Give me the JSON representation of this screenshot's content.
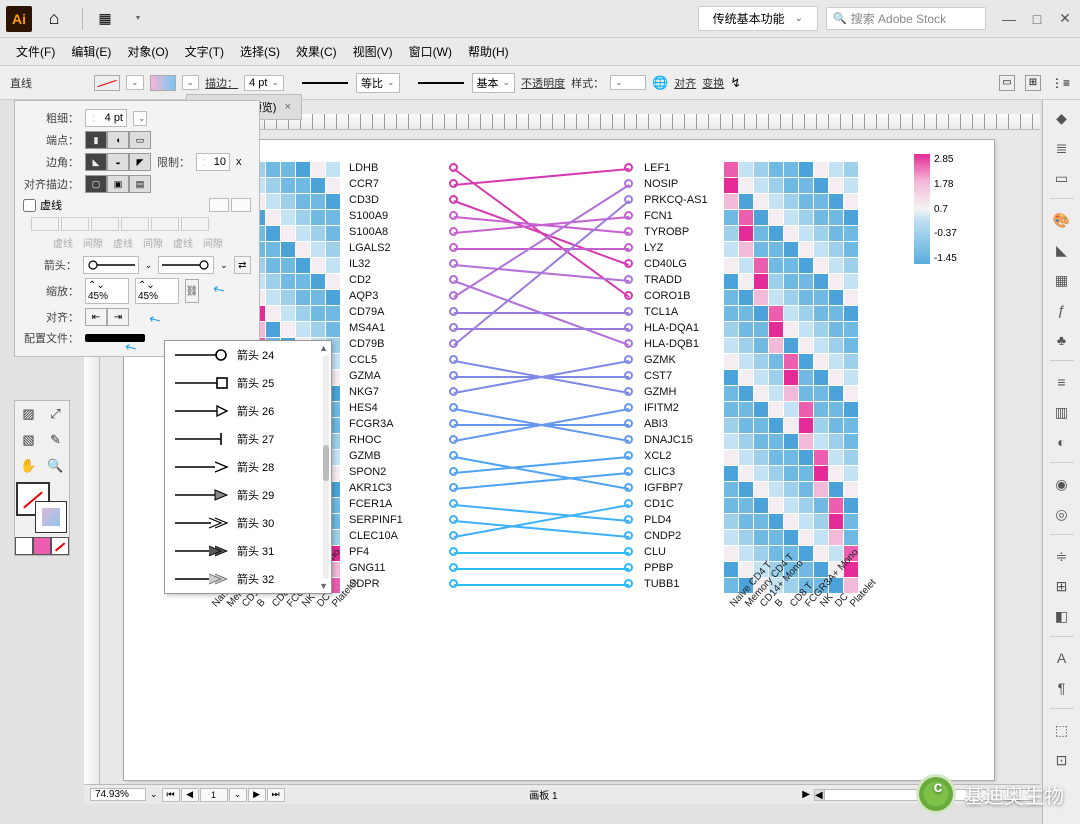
{
  "titlebar": {
    "workspace": "传统基本功能",
    "search_placeholder": "搜索 Adobe Stock"
  },
  "menubar": {
    "items": [
      "文件(F)",
      "编辑(E)",
      "对象(O)",
      "文字(T)",
      "选择(S)",
      "效果(C)",
      "视图(V)",
      "窗口(W)",
      "帮助(H)"
    ]
  },
  "ctrlbar": {
    "tool": "直线",
    "stroke_label": "描边：",
    "stroke_pt": "4 pt",
    "ratio": "等比",
    "profile": "基本",
    "opacity_label": "不透明度",
    "style_label": "样式：",
    "align": "对齐",
    "transform": "变换"
  },
  "doc_tab": {
    "title": "RGB/GPU 预览)",
    "close": "×"
  },
  "stroke_panel": {
    "weight_label": "粗细：",
    "weight_val": "4 pt",
    "cap_label": "端点：",
    "corner_label": "边角：",
    "limit_label": "限制：",
    "limit_val": "10",
    "limit_unit": "x",
    "align_stroke_label": "对齐描边：",
    "dashed_label": "虚线",
    "dash_cols": [
      "虚线",
      "间隙",
      "虚线",
      "间隙",
      "虚线",
      "间隙"
    ],
    "arrow_label": "箭头：",
    "scale_label": "缩放：",
    "scale_val": "45%",
    "align_label": "对齐：",
    "profile_label": "配置文件："
  },
  "arrow_dropdown": {
    "items": [
      "箭头 24",
      "箭头 25",
      "箭头 26",
      "箭头 27",
      "箭头 28",
      "箭头 29",
      "箭头 30",
      "箭头 31",
      "箭头 32"
    ]
  },
  "statusbar": {
    "zoom": "74.93%",
    "artboard_nav": "1",
    "artboard_label": "画板 1"
  },
  "watermark": "基迪奥生物",
  "chart_data": {
    "type": "heatmap",
    "categories_x": [
      "Naive CD4 T",
      "Memory CD4 T",
      "CD14+ Mono",
      "B",
      "CD8 T",
      "FCGR3A+ Mono",
      "NK",
      "DC",
      "Platelet"
    ],
    "genes_left": [
      "LDHB",
      "CCR7",
      "CD3D",
      "S100A9",
      "S100A8",
      "LGALS2",
      "IL32",
      "CD2",
      "AQP3",
      "CD79A",
      "MS4A1",
      "CD79B",
      "CCL5",
      "GZMA",
      "NKG7",
      "HES4",
      "FCGR3A",
      "RHOC",
      "GZMB",
      "SPON2",
      "AKR1C3",
      "FCER1A",
      "SERPINF1",
      "CLEC10A",
      "PF4",
      "GNG11",
      "SDPR"
    ],
    "genes_right": [
      "LEF1",
      "NOSIP",
      "PRKCQ-AS1",
      "FCN1",
      "TYROBP",
      "LYZ",
      "CD40LG",
      "TRADD",
      "CORO1B",
      "TCL1A",
      "HLA-DQA1",
      "HLA-DQB1",
      "GZMK",
      "CST7",
      "GZMH",
      "IFITM2",
      "ABI3",
      "DNAJC15",
      "XCL2",
      "CLIC3",
      "IGFBP7",
      "CD1C",
      "PLD4",
      "CNDP2",
      "CLU",
      "PPBP",
      "TUBB1"
    ],
    "legend": {
      "ticks": [
        "2.85",
        "1.78",
        "0.7",
        "-0.37",
        "-1.45"
      ]
    },
    "connectors": [
      {
        "from": 0,
        "to": 8,
        "color": "#d63ab0"
      },
      {
        "from": 1,
        "to": 0,
        "color": "#d63ab0"
      },
      {
        "from": 2,
        "to": 6,
        "color": "#d63ab0"
      },
      {
        "from": 3,
        "to": 4,
        "color": "#c65fd0"
      },
      {
        "from": 4,
        "to": 3,
        "color": "#c65fd0"
      },
      {
        "from": 5,
        "to": 5,
        "color": "#c65fd0"
      },
      {
        "from": 6,
        "to": 7,
        "color": "#b270d8"
      },
      {
        "from": 7,
        "to": 11,
        "color": "#b270d8"
      },
      {
        "from": 8,
        "to": 1,
        "color": "#b270d8"
      },
      {
        "from": 9,
        "to": 9,
        "color": "#9a7be0"
      },
      {
        "from": 10,
        "to": 10,
        "color": "#9a7be0"
      },
      {
        "from": 11,
        "to": 2,
        "color": "#9a7be0"
      },
      {
        "from": 12,
        "to": 14,
        "color": "#7f8ae8"
      },
      {
        "from": 13,
        "to": 13,
        "color": "#7f8ae8"
      },
      {
        "from": 14,
        "to": 12,
        "color": "#7f8ae8"
      },
      {
        "from": 15,
        "to": 17,
        "color": "#6697ee"
      },
      {
        "from": 16,
        "to": 16,
        "color": "#6697ee"
      },
      {
        "from": 17,
        "to": 15,
        "color": "#6697ee"
      },
      {
        "from": 18,
        "to": 20,
        "color": "#4fa3f2"
      },
      {
        "from": 19,
        "to": 18,
        "color": "#4fa3f2"
      },
      {
        "from": 20,
        "to": 19,
        "color": "#4fa3f2"
      },
      {
        "from": 21,
        "to": 22,
        "color": "#3fb1f6"
      },
      {
        "from": 22,
        "to": 23,
        "color": "#3fb1f6"
      },
      {
        "from": 23,
        "to": 21,
        "color": "#3fb1f6"
      },
      {
        "from": 24,
        "to": 24,
        "color": "#2cbcf8"
      },
      {
        "from": 25,
        "to": 25,
        "color": "#2cbcf8"
      },
      {
        "from": 26,
        "to": 26,
        "color": "#2cbcf8"
      }
    ]
  }
}
